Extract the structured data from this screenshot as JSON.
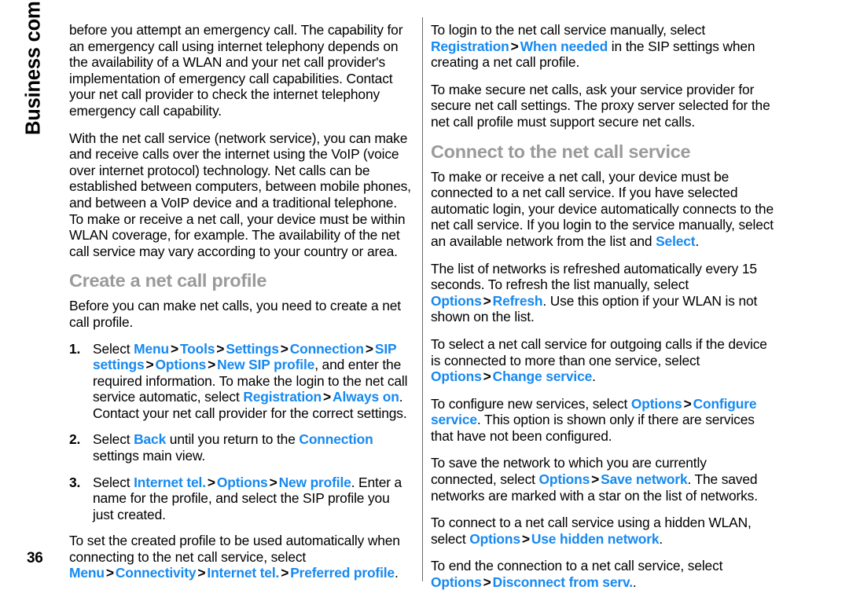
{
  "document": {
    "running_head": "Business communications",
    "page_number": "36",
    "link_color": "#1689f0",
    "heading_color": "#9a9a9a",
    "body_color": "#000000",
    "separator_glyph": ">"
  },
  "left_column": {
    "paragraphs": [
      "before you attempt an emergency call. The capability for an emergency call using internet telephony depends on the availability of a WLAN and your net call provider's implementation of emergency call capabilities. Contact your net call provider to check the internet telephony emergency call capability.",
      "With the net call service (network service), you can make and receive calls over the internet using the VoIP (voice over internet protocol) technology. Net calls can be established between computers, between mobile phones, and between a VoIP device and a traditional telephone. To make or receive a net call, your device must be within WLAN coverage, for example. The availability of the net call service may vary according to your country or area."
    ],
    "section_heading": "Create a net call profile",
    "intro": "Before you can make net calls, you need to create a net call profile.",
    "steps": [
      {
        "number": "1.",
        "parts": [
          {
            "t": "Select ",
            "k": "plain"
          },
          {
            "t": "Menu",
            "k": "link"
          },
          {
            "t": ">",
            "k": "sep"
          },
          {
            "t": "Tools",
            "k": "link"
          },
          {
            "t": ">",
            "k": "sep"
          },
          {
            "t": "Settings",
            "k": "link"
          },
          {
            "t": ">",
            "k": "sep"
          },
          {
            "t": "Connection",
            "k": "link"
          },
          {
            "t": ">",
            "k": "sep"
          },
          {
            "t": "SIP settings",
            "k": "link"
          },
          {
            "t": ">",
            "k": "sep"
          },
          {
            "t": "Options",
            "k": "link"
          },
          {
            "t": ">",
            "k": "sep"
          },
          {
            "t": "New SIP profile",
            "k": "link"
          },
          {
            "t": ", and enter the required information. To make the login to the net call service automatic, select ",
            "k": "plain"
          },
          {
            "t": "Registration",
            "k": "link"
          },
          {
            "t": ">",
            "k": "sep"
          },
          {
            "t": "Always on",
            "k": "link"
          },
          {
            "t": ". Contact your net call provider for the correct settings.",
            "k": "plain"
          }
        ]
      },
      {
        "number": "2.",
        "parts": [
          {
            "t": "Select ",
            "k": "plain"
          },
          {
            "t": "Back",
            "k": "link"
          },
          {
            "t": " until you return to the ",
            "k": "plain"
          },
          {
            "t": "Connection",
            "k": "link"
          },
          {
            "t": " settings main view.",
            "k": "plain"
          }
        ]
      },
      {
        "number": "3.",
        "parts": [
          {
            "t": "Select ",
            "k": "plain"
          },
          {
            "t": "Internet tel.",
            "k": "link"
          },
          {
            "t": ">",
            "k": "sep"
          },
          {
            "t": "Options",
            "k": "link"
          },
          {
            "t": ">",
            "k": "sep"
          },
          {
            "t": "New profile",
            "k": "link"
          },
          {
            "t": ". Enter a name for the profile, and select the SIP profile you just created.",
            "k": "plain"
          }
        ]
      }
    ],
    "trailing_note": [
      {
        "t": "To set the created profile to be used automatically when connecting to the net call service, select ",
        "k": "plain"
      },
      {
        "t": "Menu",
        "k": "link"
      },
      {
        "t": ">",
        "k": "sep"
      },
      {
        "t": "Connectivity",
        "k": "link"
      },
      {
        "t": ">",
        "k": "sep"
      },
      {
        "t": "Internet tel.",
        "k": "link"
      },
      {
        "t": ">",
        "k": "sep"
      },
      {
        "t": "Preferred profile",
        "k": "link"
      },
      {
        "t": ".",
        "k": "plain"
      }
    ]
  },
  "right_column": {
    "section_heading": "Connect to the net call service",
    "paragraphs": [
      {
        "id": "p1",
        "parts": [
          {
            "t": "To login to the net call service manually, select ",
            "k": "plain"
          },
          {
            "t": "Registration",
            "k": "link"
          },
          {
            "t": ">",
            "k": "sep"
          },
          {
            "t": "When needed",
            "k": "link"
          },
          {
            "t": " in the SIP settings when creating a net call profile.",
            "k": "plain"
          }
        ]
      },
      {
        "id": "p2",
        "parts": [
          {
            "t": "To make secure net calls, ask your service provider for secure net call settings. The proxy server selected for the net call profile must support secure net calls.",
            "k": "plain"
          }
        ]
      },
      {
        "id": "p3",
        "parts": [
          {
            "t": "To make or receive a net call, your device must be connected to a net call service. If you have selected automatic login, your device automatically connects to the net call service. If you login to the service manually, select an available network from the list and ",
            "k": "plain"
          },
          {
            "t": "Select",
            "k": "link"
          },
          {
            "t": ".",
            "k": "plain"
          }
        ]
      },
      {
        "id": "p4",
        "parts": [
          {
            "t": "The list of networks is refreshed automatically every 15 seconds. To refresh the list manually, select ",
            "k": "plain"
          },
          {
            "t": "Options",
            "k": "link"
          },
          {
            "t": ">",
            "k": "sep"
          },
          {
            "t": "Refresh",
            "k": "link"
          },
          {
            "t": ". Use this option if your WLAN is not shown on the list.",
            "k": "plain"
          }
        ]
      },
      {
        "id": "p5",
        "parts": [
          {
            "t": "To select a net call service for outgoing calls if the device is connected to more than one service, select ",
            "k": "plain"
          },
          {
            "t": "Options",
            "k": "link"
          },
          {
            "t": ">",
            "k": "sep"
          },
          {
            "t": "Change service",
            "k": "link"
          },
          {
            "t": ".",
            "k": "plain"
          }
        ]
      },
      {
        "id": "p6",
        "parts": [
          {
            "t": "To configure new services, select ",
            "k": "plain"
          },
          {
            "t": "Options",
            "k": "link"
          },
          {
            "t": ">",
            "k": "sep"
          },
          {
            "t": "Configure service",
            "k": "link"
          },
          {
            "t": ". This option is shown only if there are services that have not been configured.",
            "k": "plain"
          }
        ]
      },
      {
        "id": "p7",
        "parts": [
          {
            "t": "To save the network to which you are currently connected, select ",
            "k": "plain"
          },
          {
            "t": "Options",
            "k": "link"
          },
          {
            "t": ">",
            "k": "sep"
          },
          {
            "t": "Save network",
            "k": "link"
          },
          {
            "t": ". The saved networks are marked with a star on the list of networks.",
            "k": "plain"
          }
        ]
      },
      {
        "id": "p8",
        "parts": [
          {
            "t": "To connect to a net call service using a hidden WLAN, select ",
            "k": "plain"
          },
          {
            "t": "Options",
            "k": "link"
          },
          {
            "t": ">",
            "k": "sep"
          },
          {
            "t": "Use hidden network",
            "k": "link"
          },
          {
            "t": ".",
            "k": "plain"
          }
        ]
      },
      {
        "id": "p9",
        "parts": [
          {
            "t": "To end the connection to a net call service, select ",
            "k": "plain"
          },
          {
            "t": "Options",
            "k": "link"
          },
          {
            "t": ">",
            "k": "sep"
          },
          {
            "t": "Disconnect from serv.",
            "k": "link"
          },
          {
            "t": ".",
            "k": "plain"
          }
        ]
      }
    ]
  }
}
